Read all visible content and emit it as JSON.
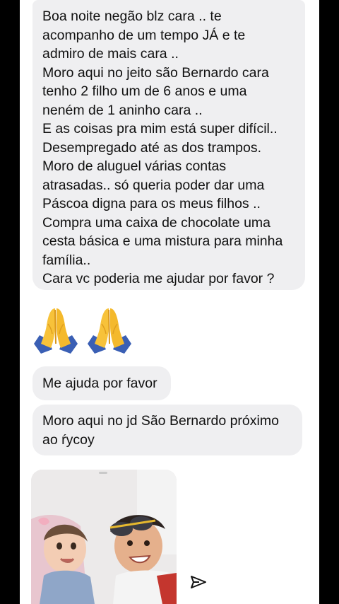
{
  "messages": [
    {
      "text": "Boa noite negão blz cara .. te\nacompanho de um tempo JÁ e te\nadmiro de mais cara ..\nMoro aqui no jeito são Bernardo cara\ntenho 2 filho um de 6 anos e uma\nneném de 1 aninho cara ..\nE as coisas pra mim está super difícil..\nDesempregado até as dos trampos.\nMoro de aluguel várias contas\natrasadas.. só queria poder dar uma\nPáscoa digna para os meus filhos ..\nCompra uma caixa de chocolate uma\ncesta básica e uma mistura para minha\nfamília..\nCara vc poderia me ajudar por favor  ?"
    },
    {
      "emoji": "🙏🙏"
    },
    {
      "text": "Me ajuda por favor"
    },
    {
      "text": "Moro aqui no jd São Bernardo próximo\nao ŕycoy"
    }
  ],
  "icons": {
    "emoji": "folded-hands",
    "share": "send-arrow-icon"
  },
  "colors": {
    "bubble_bg": "#efeff1",
    "text": "#111111",
    "frame": "#000000"
  }
}
